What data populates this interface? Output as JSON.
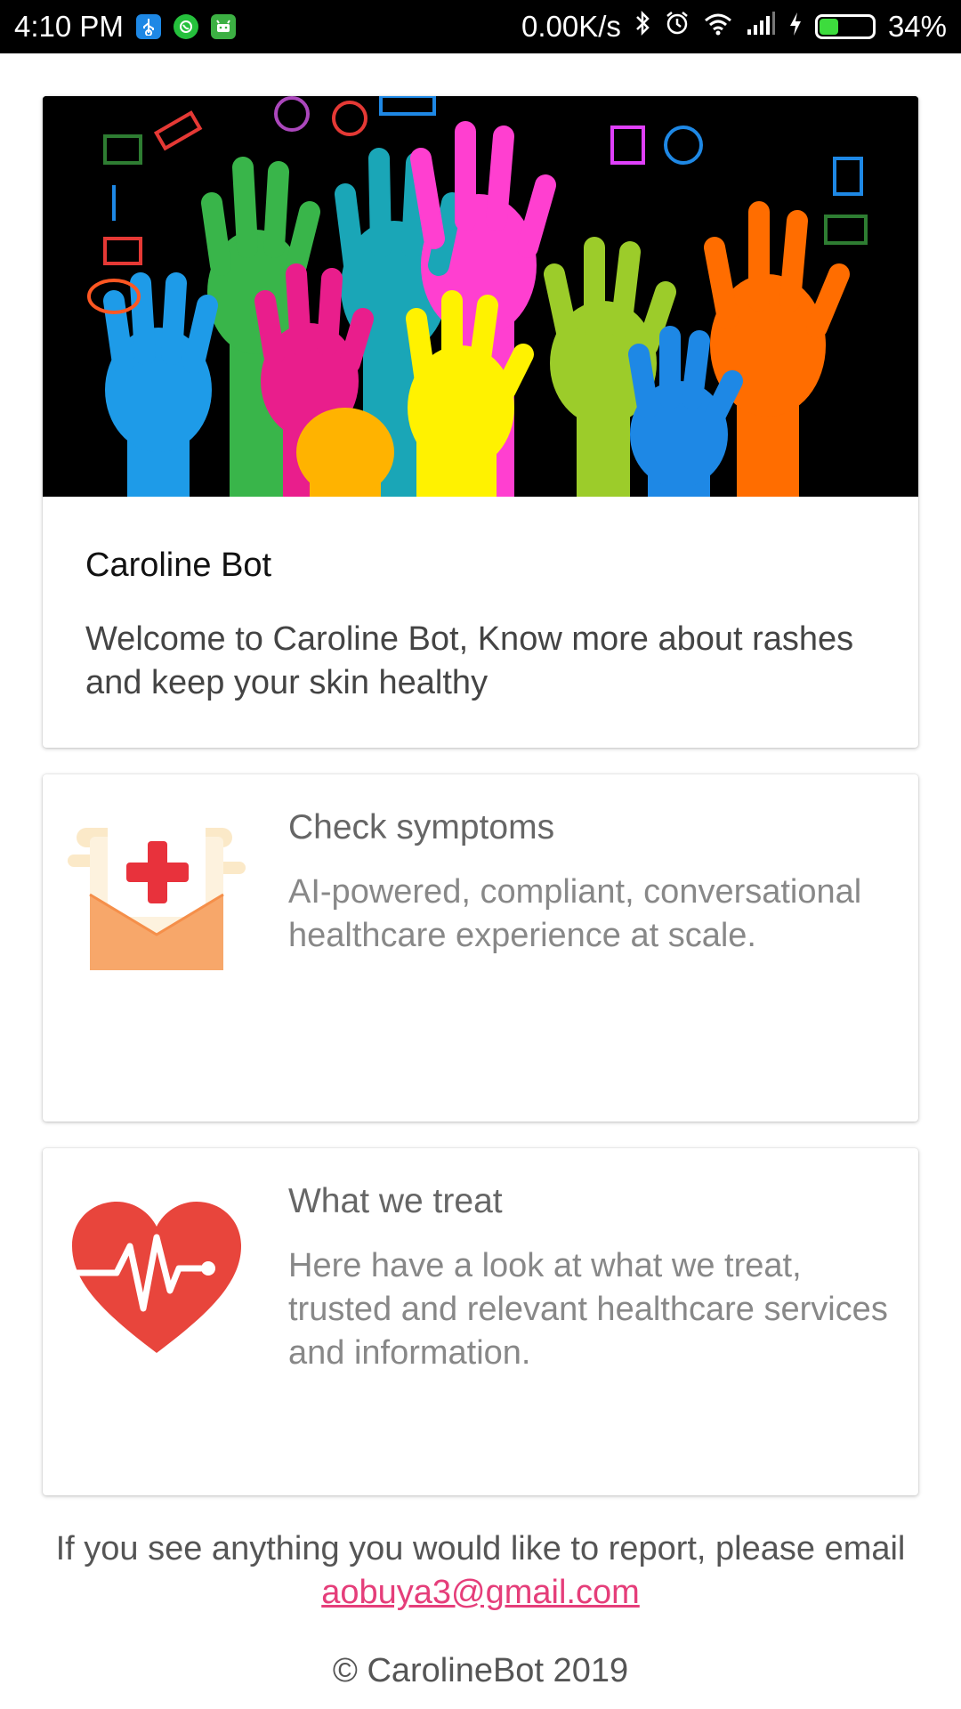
{
  "status_bar": {
    "time": "4:10 PM",
    "network_speed": "0.00K/s",
    "battery_percent": "34%",
    "battery_level": 0.34,
    "icons": [
      "usb-icon",
      "whatsapp-icon",
      "android-icon",
      "bluetooth-icon",
      "alarm-icon",
      "wifi-icon",
      "signal-icon",
      "charging-icon",
      "battery-icon"
    ]
  },
  "hero": {
    "title": "Caroline Bot",
    "description": "Welcome to Caroline Bot, Know more about rashes and keep your skin healthy"
  },
  "features": [
    {
      "title": "Check symptoms",
      "description": "AI-powered, compliant, conversational healthcare experience at scale.",
      "icon": "medical-envelope-icon"
    },
    {
      "title": "What we treat",
      "description": "Here have a look at what we treat, trusted and relevant healthcare services and information.",
      "icon": "heartbeat-icon"
    }
  ],
  "footer": {
    "text": "If you see anything you would like to report, please email",
    "email": "aobuya3@gmail.com",
    "copyright": "© CarolineBot 2019"
  },
  "colors": {
    "link": "#e53e7a",
    "heart": "#e8453c",
    "envelope": "#f7a76a"
  }
}
